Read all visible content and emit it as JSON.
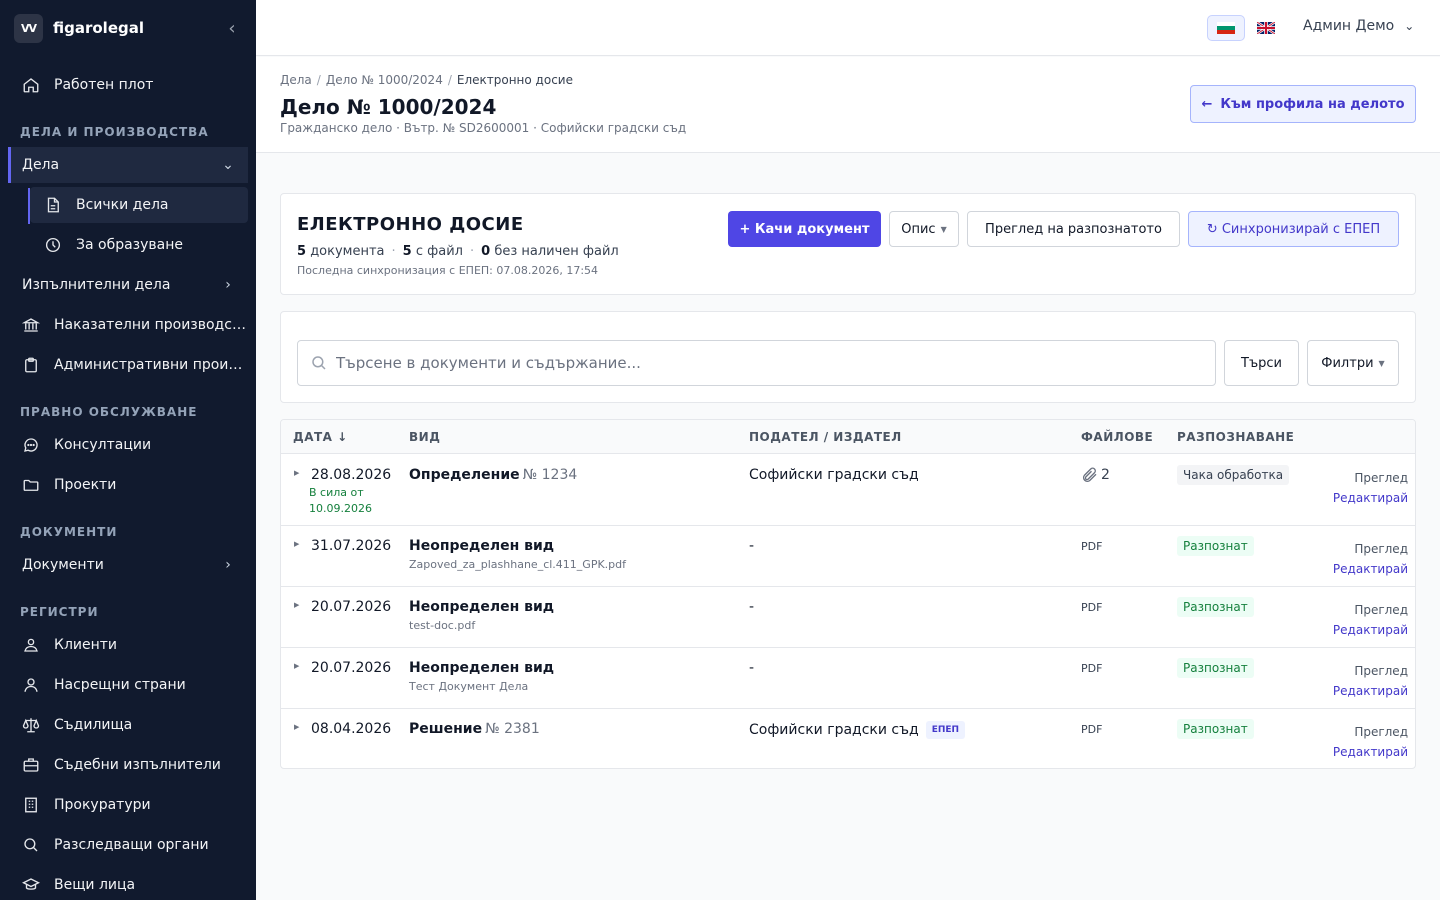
{
  "app": {
    "logo": "VV",
    "name": "figarolegal",
    "collapse_icon": "chevron-left-icon"
  },
  "sidebar": {
    "dashboard": "Работен плот",
    "sections": {
      "cases": "ДЕЛА И ПРОИЗВОДСТВА",
      "legal": "ПРАВНО ОБСЛУЖВАНЕ",
      "documents": "ДОКУМЕНТИ",
      "registers": "РЕГИСТРИ"
    },
    "cases": "Дела",
    "all_cases": "Всички дела",
    "for_creation": "За образуване",
    "enforcement": "Изпълнителни дела",
    "criminal": "Наказателни производства",
    "administrative": "Административни производства",
    "consultations": "Консултации",
    "projects": "Проекти",
    "documents": "Документи",
    "clients": "Клиенти",
    "counterparties": "Насрещни страни",
    "courts": "Съдилища",
    "bailiffs": "Съдебни изпълнители",
    "prosecutors": "Прокуратури",
    "investigators": "Разследващи органи",
    "third_parties": "Вещи лица"
  },
  "topbar": {
    "languages": [
      "bg",
      "en"
    ],
    "active_language": "bg",
    "user": "Админ Демо"
  },
  "header": {
    "breadcrumbs": [
      "Дела",
      "Дело № 1000/2024",
      "Електронно досие"
    ],
    "title": "Дело № 1000/2024",
    "subtitle": "Гражданско дело · Вътр. № SD2600001 · Софийски градски съд",
    "back_button": "Към профила на делото"
  },
  "dossier": {
    "title": "ЕЛЕКТРОННО ДОСИЕ",
    "stats": [
      {
        "count": "5",
        "label": "документа"
      },
      {
        "count": "5",
        "label": "с файл"
      },
      {
        "count": "0",
        "label": "без наличен файл"
      }
    ],
    "last_sync": "Последна синхронизация с ЕПЕП: 07.08.2026, 17:54",
    "upload_button": "+ Качи документ",
    "sort_select": "Опис",
    "review_button": "Преглед на разпознатото",
    "sync_button": "↻ Синхронизирай с ЕПЕП"
  },
  "search": {
    "placeholder": "Търсене в документи и съдържание...",
    "value": "",
    "search_button": "Търси",
    "filters_button": "Филтри"
  },
  "table": {
    "columns": [
      "ДАТА ↓",
      "ВИД",
      "ПОДАТЕЛ / ИЗДАТЕЛ",
      "ФАЙЛОВЕ",
      "РАЗПОЗНАВАНЕ"
    ],
    "view_label": "Преглед",
    "edit_label": "Редактирай",
    "rows": [
      {
        "date": "28.08.2026",
        "effective_label": "В сила от",
        "effective_date": "10.09.2026",
        "kind": "Определение",
        "number": "№ 1234",
        "file_name": "",
        "sender": "Софийски градски съд",
        "tag": "",
        "files": "2",
        "status": "Чака обработка"
      },
      {
        "date": "31.07.2026",
        "kind": "Неопределен вид",
        "number": "",
        "file_name": "Zapoved_za_plashhane_cl.411_GPK.pdf",
        "sender": "-",
        "tag": "",
        "files": "PDF",
        "status": "Разпознат"
      },
      {
        "date": "20.07.2026",
        "kind": "Неопределен вид",
        "number": "",
        "file_name": "test-doc.pdf",
        "sender": "-",
        "tag": "",
        "files": "PDF",
        "status": "Разпознат"
      },
      {
        "date": "20.07.2026",
        "kind": "Неопределен вид",
        "number": "",
        "file_name": "Тест Документ Дела",
        "sender": "-",
        "tag": "",
        "files": "PDF",
        "status": "Разпознат"
      },
      {
        "date": "08.04.2026",
        "kind": "Решение",
        "number": "№ 2381",
        "file_name": "",
        "sender": "Софийски градски съд",
        "tag": "ЕПЕП",
        "files": "PDF",
        "status": "Разпознат"
      }
    ]
  },
  "colors": {
    "sidebar_bg": "#111a2e",
    "accent": "#4f46e5",
    "success": "#15803d"
  }
}
